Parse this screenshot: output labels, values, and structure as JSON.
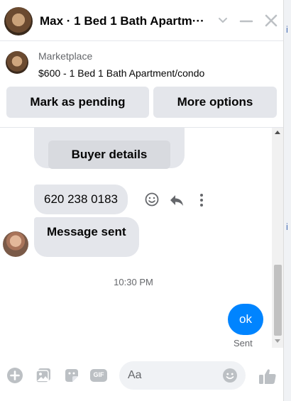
{
  "header": {
    "title": "Max · 1 Bed 1 Bath Apartm···",
    "avatar_icon": "listing-photo",
    "chevron_icon": "chevron-down-icon",
    "minimize_icon": "minimize-icon",
    "close_icon": "close-icon"
  },
  "marketplace": {
    "label": "Marketplace",
    "listing": "$600 - 1 Bed 1 Bath Apartment/condo",
    "buttons": {
      "pending": "Mark as pending",
      "more": "More options"
    }
  },
  "messages": {
    "buyer_details_label": "Buyer details",
    "phone": "620 238 0183",
    "system_message": "Message sent",
    "time": "10:30 PM",
    "own_message": "ok",
    "own_status": "Sent"
  },
  "composer": {
    "placeholder": "Aa",
    "gif_label": "GIF"
  },
  "colors": {
    "accent": "#0084ff",
    "bubble": "#e4e6eb",
    "icon": "#bcc0c4"
  }
}
